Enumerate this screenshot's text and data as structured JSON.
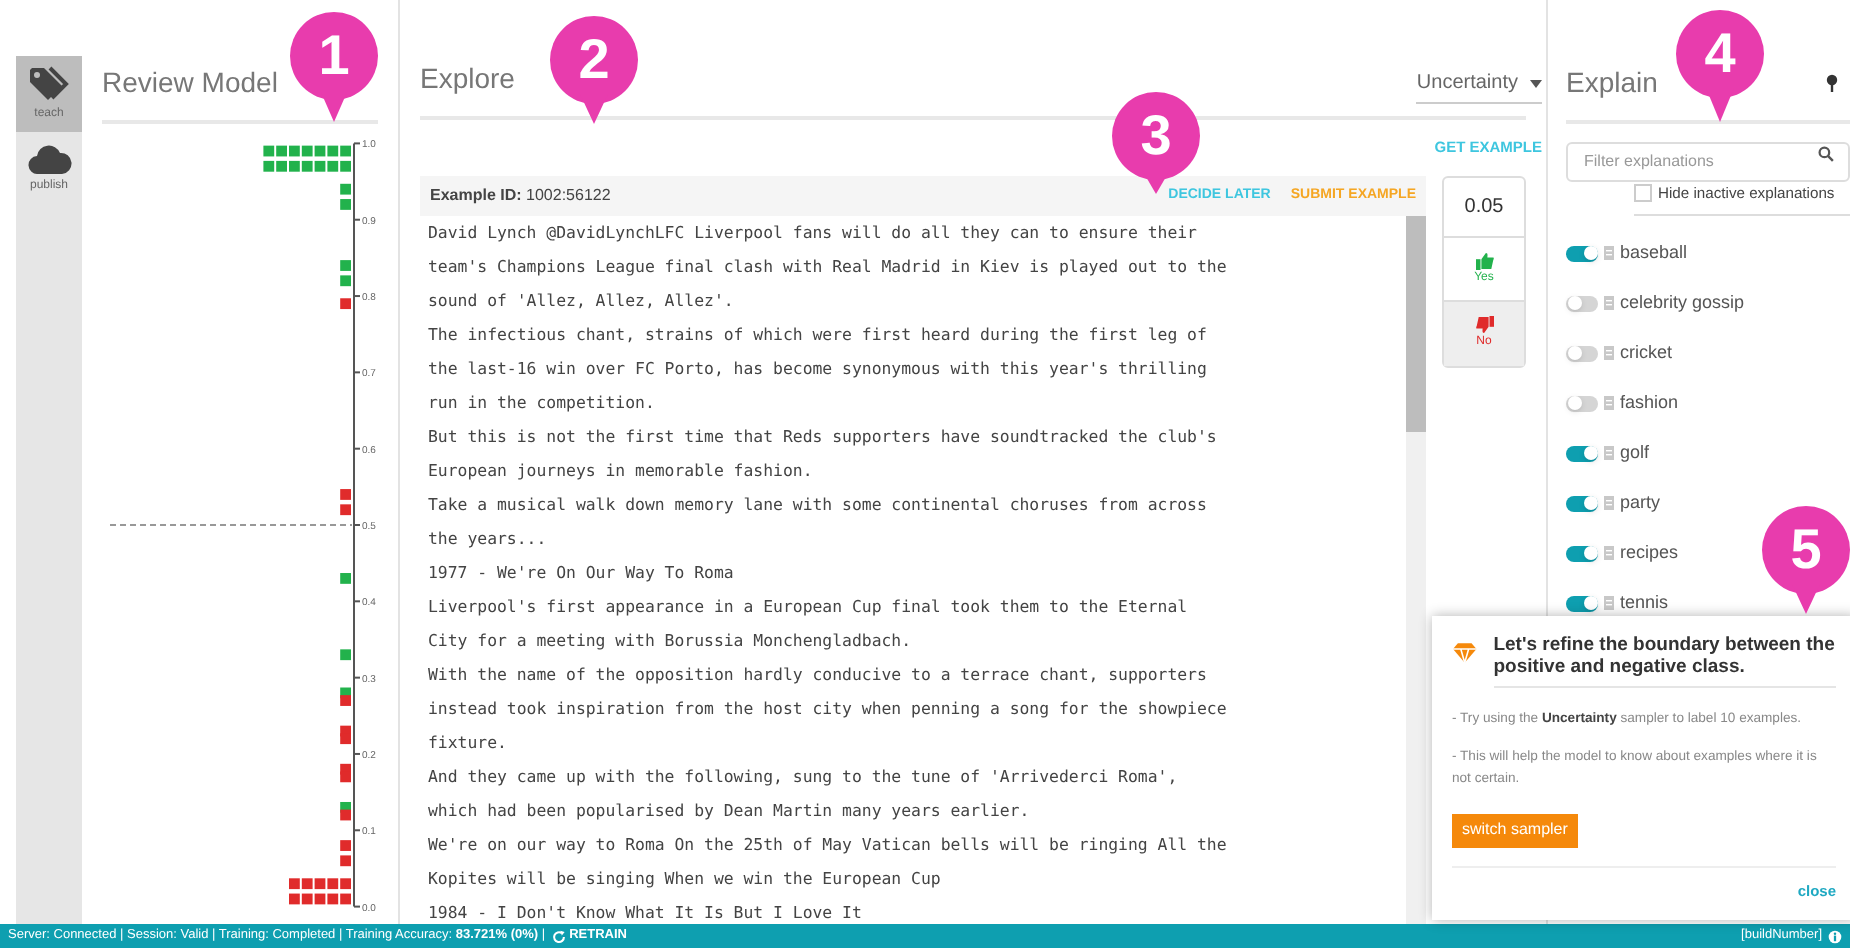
{
  "nav": [
    {
      "label": "teach",
      "selected": true
    },
    {
      "label": "publish",
      "selected": false
    }
  ],
  "review": {
    "title": "Review Model",
    "axis_labels": [
      "1.0",
      "0.9",
      "0.8",
      "0.7",
      "0.6",
      "0.5",
      "0.4",
      "0.3",
      "0.2",
      "0.1",
      "0.0"
    ]
  },
  "explore": {
    "title": "Explore",
    "sampler": "Uncertainty",
    "get_example": "GET EXAMPLE",
    "example_label": "Example ID:",
    "example_id": "1002:56122",
    "decide_later": "DECIDE LATER",
    "submit": "SUBMIT EXAMPLE",
    "lines": [
      "David Lynch @DavidLynchLFC Liverpool fans will do all they can to ensure their",
      "team's Champions League final clash with Real Madrid in Kiev is played out to the",
      "sound of 'Allez, Allez, Allez'.",
      "The infectious chant, strains of which were first heard during the first leg of",
      "the last-16 win over FC Porto, has become synonymous with this year's thrilling",
      "run in the competition.",
      "But this is not the first time that Reds supporters have soundtracked the club's",
      "European journeys in memorable fashion.",
      "Take a musical walk down memory lane with some continental choruses from across",
      "the years...",
      "1977 - We're On Our Way To Roma",
      "Liverpool's first appearance in a European Cup final took them to the Eternal",
      "City for a meeting with Borussia Monchengladbach.",
      "With the name of the opposition hardly conducive to a terrace chant, supporters",
      "instead took inspiration from the host city when penning a song for the showpiece",
      "fixture.",
      "And they came up with the following, sung to the tune of 'Arrivederci Roma',",
      "which had been popularised by Dean Martin many years earlier.",
      "We're on our way to Roma On the 25th of May Vatican bells will be ringing All the",
      "Kopites will be singing When we win the European Cup",
      "1984 - I Don't Know What It Is But I Love It"
    ],
    "score": "0.05",
    "yes": "Yes",
    "no": "No"
  },
  "explain": {
    "title": "Explain",
    "filter_placeholder": "Filter explanations",
    "hide_inactive": {
      "label": "Hide inactive explanations",
      "checked": false
    },
    "items": [
      {
        "label": "baseball",
        "on": true
      },
      {
        "label": "celebrity gossip",
        "on": false
      },
      {
        "label": "cricket",
        "on": false
      },
      {
        "label": "fashion",
        "on": false
      },
      {
        "label": "golf",
        "on": true
      },
      {
        "label": "party",
        "on": true
      },
      {
        "label": "recipes",
        "on": true
      },
      {
        "label": "tennis",
        "on": true
      }
    ]
  },
  "popup": {
    "title": "Let's refine the boundary between the positive and negative class.",
    "lines": [
      "- Try using the **Uncertainty** sampler to label 10 examples.",
      "- This will help the model to know about examples where it is not certain."
    ],
    "button": "switch sampler",
    "close": "close"
  },
  "markers": [
    "1",
    "2",
    "3",
    "4",
    "5"
  ],
  "status_bar": {
    "text": "Server: Connected | Session: Valid | Training: Completed | Training Accuracy: **83.721% (0%)** |",
    "retrain": "RETRAIN",
    "build": "[buildNumber]"
  }
}
